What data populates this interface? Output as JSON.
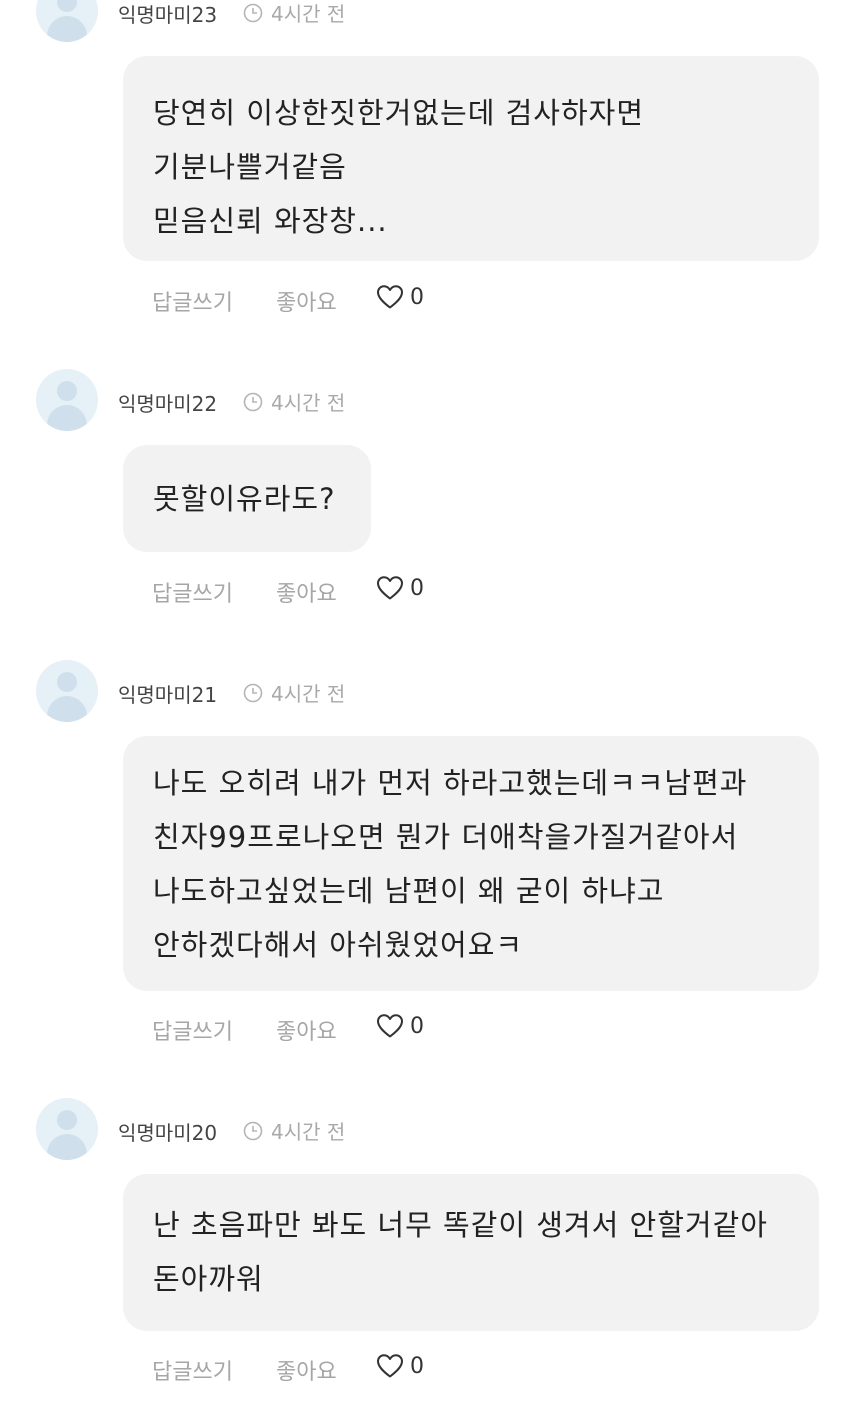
{
  "actions": {
    "reply_label": "답글쓰기",
    "like_label": "좋아요"
  },
  "comments": [
    {
      "nickname": "익명마미23",
      "time": "4시간 전",
      "lines": [
        "당연히 이상한짓한거없는데 검사하자면",
        "기분나쁠거같음",
        "믿음신뢰 와장창..."
      ],
      "likes": "0"
    },
    {
      "nickname": "익명마미22",
      "time": "4시간 전",
      "lines": [
        "못할이유라도?"
      ],
      "likes": "0"
    },
    {
      "nickname": "익명마미21",
      "time": "4시간 전",
      "lines": [
        "나도 오히려 내가 먼저 하라고했는데ㅋㅋ남편과",
        "친자99프로나오면 뭔가 더애착을가질거같아서",
        "나도하고싶었는데 남편이 왜 굳이 하냐고",
        "안하겠다해서 아쉬웠었어요ㅋ"
      ],
      "likes": "0"
    },
    {
      "nickname": "익명마미20",
      "time": "4시간 전",
      "lines": [
        "난 초음파만 봐도 너무 똑같이 생겨서 안할거같아",
        "돈아까워"
      ],
      "likes": "0"
    }
  ]
}
